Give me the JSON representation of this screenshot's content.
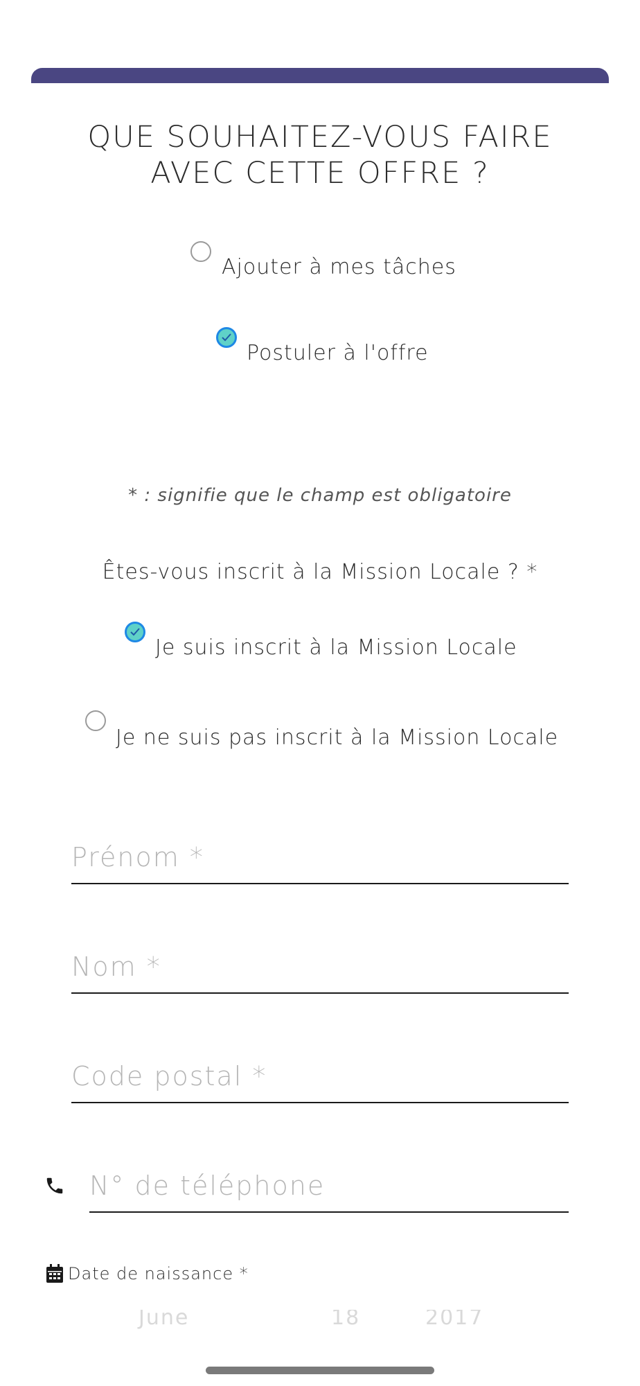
{
  "header": {
    "title_line1": "QUE SOUHAITEZ-VOUS FAIRE",
    "title_line2": "AVEC CETTE OFFRE ?",
    "accent_color": "#4a4682"
  },
  "action_options": [
    {
      "label": "Ajouter à mes tâches",
      "checked": false
    },
    {
      "label": "Postuler à l'offre",
      "checked": true
    }
  ],
  "required_note": "* : signifie que le champ est obligatoire",
  "mission_locale": {
    "question": "Êtes-vous inscrit à la Mission Locale ? *",
    "options": [
      {
        "label": "Je suis inscrit à la Mission Locale",
        "checked": true
      },
      {
        "label": "Je ne suis pas inscrit à la Mission Locale",
        "checked": false
      }
    ]
  },
  "form": {
    "first_name_placeholder": "Prénom *",
    "last_name_placeholder": "Nom *",
    "postal_code_placeholder": "Code postal *",
    "phone_placeholder": "N° de téléphone",
    "birth_date_label": "Date de naissance *",
    "date_picker": {
      "month": "June",
      "day": "18",
      "year": "2017"
    }
  },
  "icons": {
    "phone": "phone-icon",
    "calendar": "calendar-icon",
    "check": "check-icon"
  },
  "colors": {
    "checked_fill": "#5fd1c8",
    "checked_border": "#1e88e5"
  }
}
